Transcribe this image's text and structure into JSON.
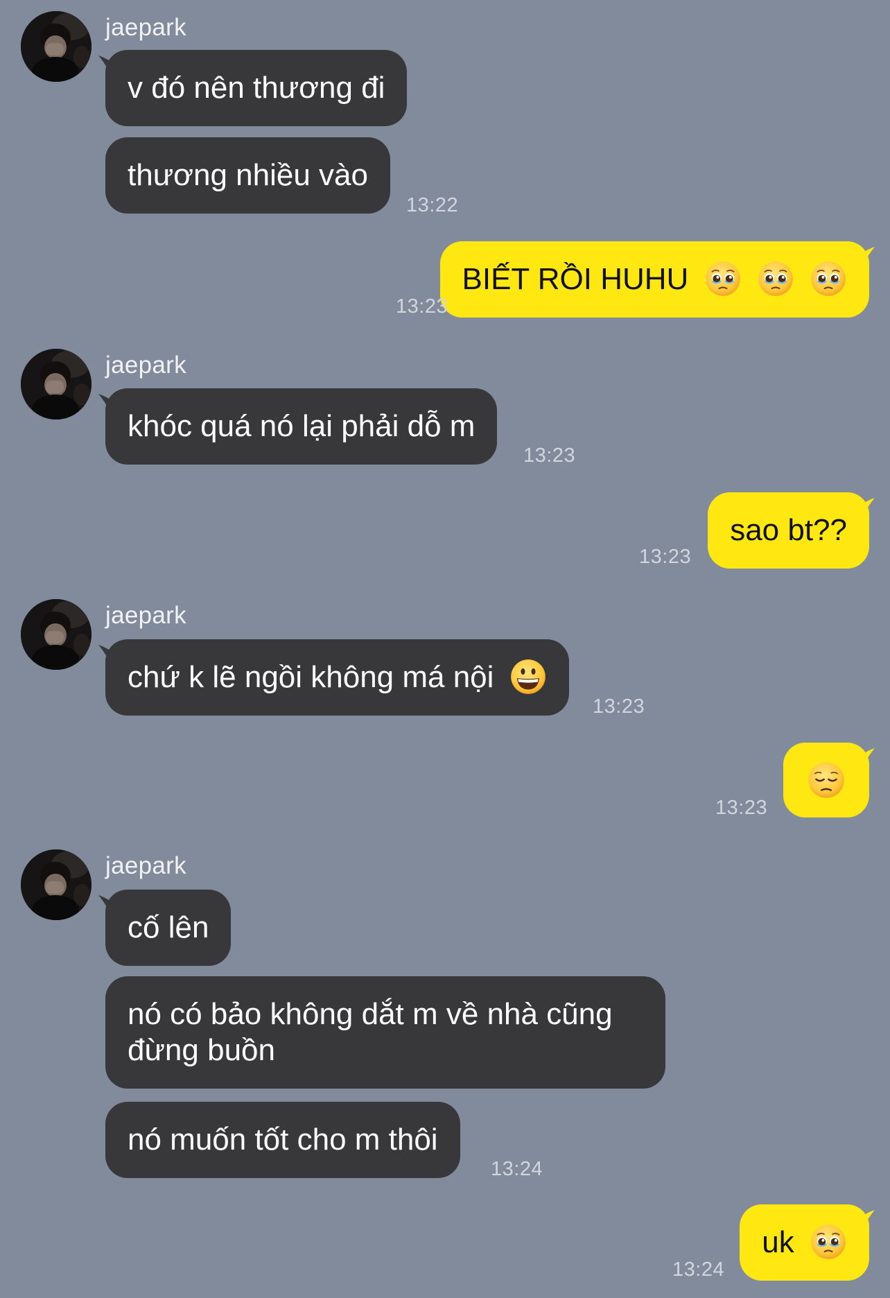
{
  "chat": {
    "sender_name": "jaepark",
    "colors": {
      "background": "#828B9B",
      "incoming_bubble": "#38383B",
      "outgoing_bubble": "#FFE812"
    },
    "messages": [
      {
        "from": "jaepark",
        "text": "v đó nên thương đi"
      },
      {
        "from": "jaepark",
        "text": "thương nhiều vào",
        "time": "13:22"
      },
      {
        "from": "me",
        "text": "BIẾT RỒI HUHU",
        "emoji": [
          "pleading-face-icon",
          "pleading-face-icon",
          "pleading-face-icon"
        ],
        "time": "13:23"
      },
      {
        "from": "jaepark",
        "text": "khóc quá nó lại phải dỗ m",
        "time": "13:23"
      },
      {
        "from": "me",
        "text": "sao bt??",
        "time": "13:23"
      },
      {
        "from": "jaepark",
        "text": "chứ k lẽ ngồi không má nội",
        "emoji": [
          "grinning-face-icon"
        ],
        "time": "13:23"
      },
      {
        "from": "me",
        "text": "",
        "emoji": [
          "pensive-face-icon"
        ],
        "time": "13:23"
      },
      {
        "from": "jaepark",
        "text": "cố lên"
      },
      {
        "from": "jaepark",
        "text": "nó có bảo không dắt m về nhà cũng đừng buồn"
      },
      {
        "from": "jaepark",
        "text": "nó muốn tốt cho m thôi",
        "time": "13:24"
      },
      {
        "from": "me",
        "text": "uk",
        "emoji": [
          "pleading-face-icon"
        ],
        "time": "13:24"
      }
    ]
  }
}
